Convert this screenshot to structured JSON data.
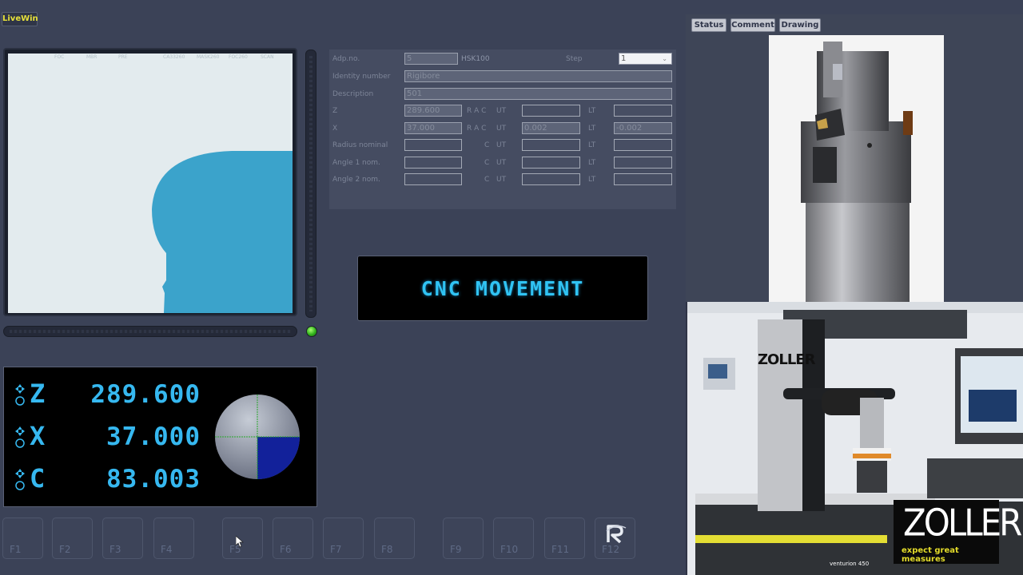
{
  "app": {
    "badge": "LiveWin"
  },
  "view": {
    "headers": [
      "FOC",
      "MBR",
      "PRE",
      "CA33260",
      "MASK260",
      "FOC260",
      "SCAN"
    ]
  },
  "form": {
    "adp_label": "Adp.no.",
    "adp_value": "5",
    "adp_type": "HSK100",
    "step_label": "Step",
    "step_value": "1",
    "identity_label": "Identity number",
    "identity_value": "Rigibore",
    "description_label": "Description",
    "description_value": "501",
    "rows": [
      {
        "label": "Z",
        "value": "289.600",
        "mode": "R A C",
        "ut_label": "UT",
        "ut_value": "",
        "lt_label": "LT",
        "lt_value": ""
      },
      {
        "label": "X",
        "value": "37.000",
        "mode": "R A C",
        "ut_label": "UT",
        "ut_value": "0.002",
        "lt_label": "LT",
        "lt_value": "-0.002"
      },
      {
        "label": "Radius nominal",
        "value": "",
        "mode": "C",
        "ut_label": "UT",
        "ut_value": "",
        "lt_label": "LT",
        "lt_value": ""
      },
      {
        "label": "Angle 1 nom.",
        "value": "",
        "mode": "C",
        "ut_label": "UT",
        "ut_value": "",
        "lt_label": "LT",
        "lt_value": ""
      },
      {
        "label": "Angle 2 nom.",
        "value": "",
        "mode": "C",
        "ut_label": "UT",
        "ut_value": "",
        "lt_label": "LT",
        "lt_value": ""
      }
    ]
  },
  "status_display": {
    "text": "CNC MOVEMENT"
  },
  "dro": {
    "axes": [
      {
        "axis": "Z",
        "value": "289.600"
      },
      {
        "axis": "X",
        "value": "37.000"
      },
      {
        "axis": "C",
        "value": "83.003"
      }
    ]
  },
  "function_keys": [
    "F1",
    "F2",
    "F3",
    "F4",
    "F5",
    "F6",
    "F7",
    "F8",
    "F9",
    "F10",
    "F11",
    "F12"
  ],
  "right_tabs": [
    "Status",
    "Comment",
    "Drawing"
  ],
  "video": {
    "brand": "ZOLLER",
    "slogan": "expect great measures",
    "machine_label": "ZOLLER",
    "model_label": "venturion 450"
  },
  "colors": {
    "accent": "#36b8f0",
    "background": "#3b4257",
    "led": "#2fb11b",
    "contour": "#3ba3cb"
  }
}
